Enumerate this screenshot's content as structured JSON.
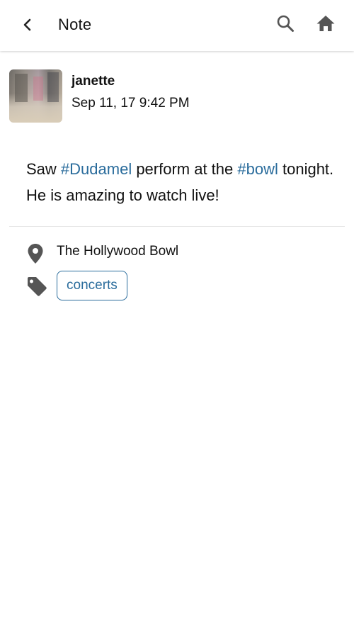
{
  "header": {
    "title": "Note",
    "back_icon": "chevron-left-icon",
    "search_icon": "search-icon",
    "home_icon": "home-icon"
  },
  "post": {
    "author": "janette",
    "timestamp": "Sep 11, 17 9:42 PM",
    "body": {
      "part1": "Saw ",
      "hashtag1": "#Dudamel",
      "part2": " perform at the ",
      "hashtag2": "#bowl",
      "part3": " tonight. He is amazing to watch live!"
    },
    "location": "The Hollywood Bowl",
    "tags": [
      "concerts"
    ]
  },
  "colors": {
    "accent": "#2a6c9c",
    "text": "#111111",
    "icon": "#555555",
    "divider": "#e5e5e5"
  }
}
